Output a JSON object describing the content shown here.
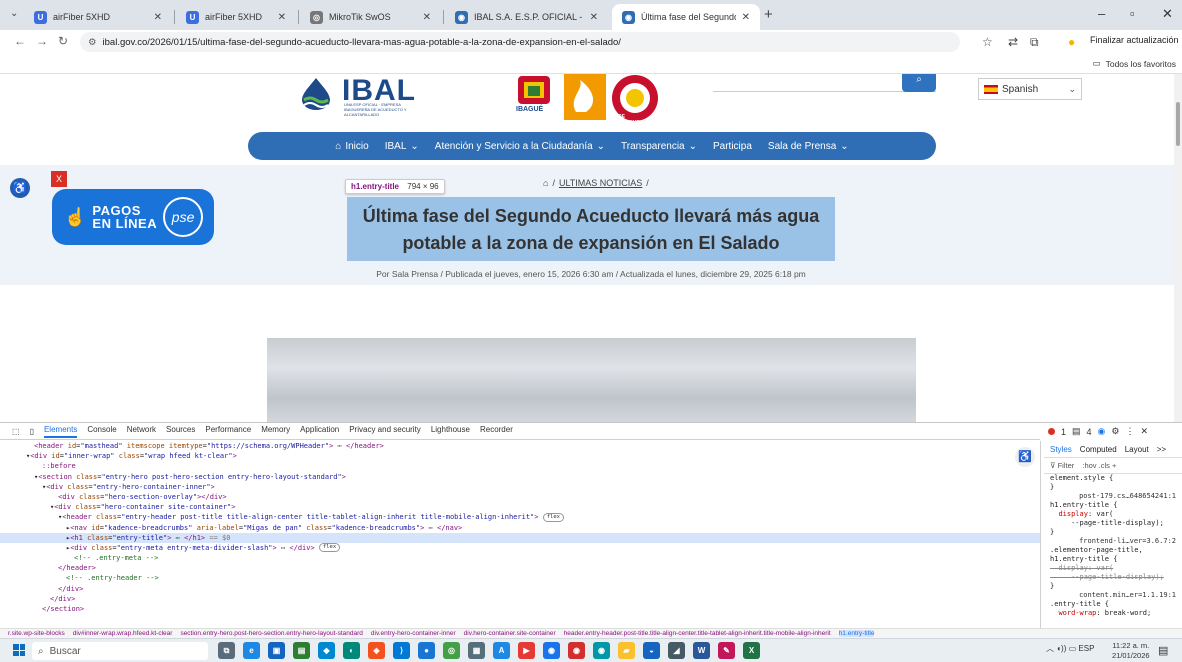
{
  "browser": {
    "tabs": [
      {
        "title": "airFiber 5XHD",
        "fav_color": "#3c6ee0",
        "fav_letter": "U",
        "active": false
      },
      {
        "title": "airFiber 5XHD",
        "fav_color": "#3c6ee0",
        "fav_letter": "U",
        "active": false
      },
      {
        "title": "MikroTik SwOS",
        "fav_color": "#777777",
        "fav_letter": "◎",
        "active": false
      },
      {
        "title": "IBAL S.A. E.S.P. OFICIAL - IBAL",
        "fav_color": "#2f6db5",
        "fav_letter": "◉",
        "active": false
      },
      {
        "title": "Última fase del Segundo Acued",
        "fav_color": "#2f6db5",
        "fav_letter": "◉",
        "active": true
      }
    ],
    "url": "ibal.gov.co/2026/01/15/ultima-fase-del-segundo-acueducto-llevara-mas-agua-potable-a-la-zona-de-expansion-en-el-salado/",
    "update_label": "Finalizar actualización",
    "bookmarks_all": "Todos los favoritos"
  },
  "site": {
    "logo_text": "IBAL",
    "logo_sub": "UNA ESP OFICIAL · EMPRESA IBAGUEREÑA DE ACUEDUCTO Y ALCANTARILLADO",
    "emblem_ibague": "IBAGUÉ",
    "emblem_colombia": "DE COLOMBIA",
    "language": "Spanish",
    "nav": [
      {
        "label": "Inicio",
        "caret": false
      },
      {
        "label": "IBAL",
        "caret": true
      },
      {
        "label": "Atención y Servicio a la Ciudadanía",
        "caret": true
      },
      {
        "label": "Transparencia",
        "caret": true
      },
      {
        "label": "Participa",
        "caret": false
      },
      {
        "label": "Sala de Prensa",
        "caret": true
      }
    ],
    "ad_close": "X",
    "pse_line1": "PAGOS",
    "pse_line2": "EN LÍNEA",
    "pse_logo": "pse",
    "tooltip_tag": "h1.entry-title",
    "tooltip_size": "794 × 96",
    "breadcrumb_link": "ULTIMAS NOTICIAS",
    "breadcrumb_sep": "/",
    "post_title": "Última fase del Segundo Acueducto llevará más agua potable a la zona de expansión en El Salado",
    "post_meta": "Por Sala Prensa  /  Publicada el jueves, enero 15, 2026 6:30 am  /  Actualizada el lunes, diciembre 29, 2025 6:18 pm"
  },
  "devtools": {
    "tabs": [
      "Elements",
      "Console",
      "Network",
      "Sources",
      "Performance",
      "Memory",
      "Application",
      "Privacy and security",
      "Lighthouse",
      "Recorder"
    ],
    "issues": "1",
    "warnings": "4",
    "styles_tabs": [
      "Styles",
      "Computed",
      "Layout",
      ">>"
    ],
    "filter_placeholder": "Filter",
    "filter_tools": ":hov  .cls  +",
    "crumbs": [
      "r.site.wp-site-blocks",
      "div#inner-wrap.wrap.hfeed.kt-clear",
      "section.entry-hero.post-hero-section.entry-hero-layout-standard",
      "div.entry-hero-container-inner",
      "div.hero-container.site-container",
      "header.entry-header.post-title.title-align-center.title-tablet-align-inherit.title-mobile-align-inherit",
      "h1.entry-title"
    ]
  },
  "taskbar": {
    "search_label": "Buscar",
    "lang": "ESP",
    "time": "11:22 a. m.",
    "date": "21/01/2026"
  }
}
